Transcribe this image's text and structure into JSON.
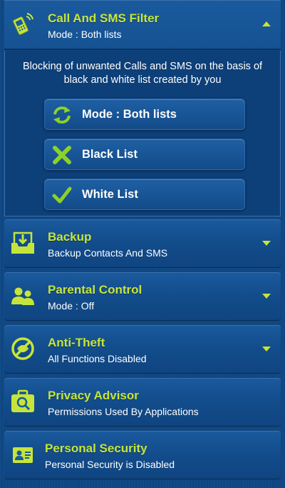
{
  "colors": {
    "accent": "#c6e53a",
    "background": "#124a86",
    "text": "#ffffff"
  },
  "call_sms_filter": {
    "title": "Call And SMS Filter",
    "subtitle": "Mode : Both lists",
    "icon": "phone-signal-icon",
    "description_line1": "Blocking of unwanted Calls and SMS on the basis of",
    "description_line2": "black and white list created by you",
    "options": [
      {
        "label": "Mode : Both lists",
        "icon": "refresh-arrows-icon"
      },
      {
        "label": "Black List",
        "icon": "x-mark-icon"
      },
      {
        "label": "White List",
        "icon": "checkmark-icon"
      }
    ]
  },
  "sections": [
    {
      "title": "Backup",
      "subtitle": "Backup Contacts And SMS",
      "icon": "inbox-download-icon"
    },
    {
      "title": "Parental Control",
      "subtitle": "Mode : Off",
      "icon": "family-icon"
    },
    {
      "title": "Anti-Theft",
      "subtitle": "All Functions Disabled",
      "icon": "no-thief-icon"
    },
    {
      "title": "Privacy Advisor",
      "subtitle": "Permissions Used By Applications",
      "icon": "briefcase-search-icon"
    },
    {
      "title": "Personal Security",
      "subtitle": "Personal Security is Disabled",
      "icon": "id-card-icon"
    }
  ]
}
